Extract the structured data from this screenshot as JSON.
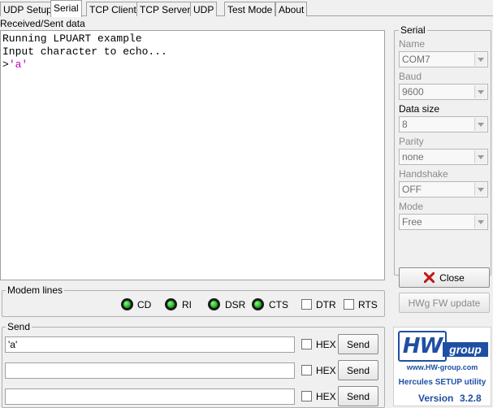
{
  "tabs": [
    {
      "label": "UDP Setup"
    },
    {
      "label": "Serial"
    },
    {
      "label": "TCP Client"
    },
    {
      "label": "TCP Server"
    },
    {
      "label": "UDP"
    },
    {
      "label": "Test Mode"
    },
    {
      "label": "About"
    }
  ],
  "active_tab": "Serial",
  "received": {
    "label": "Received/Sent data",
    "lines": [
      {
        "text": "Running LPUART example"
      },
      {
        "text": "Input character to echo..."
      }
    ],
    "prompt": ">",
    "echo": "'a'"
  },
  "serial": {
    "title": "Serial",
    "name_label": "Name",
    "name_value": "COM7",
    "baud_label": "Baud",
    "baud_value": "9600",
    "datasize_label": "Data size",
    "datasize_value": "8",
    "parity_label": "Parity",
    "parity_value": "none",
    "handshake_label": "Handshake",
    "handshake_value": "OFF",
    "mode_label": "Mode",
    "mode_value": "Free",
    "close_label": "Close",
    "hwg_label": "HWg FW update"
  },
  "modem": {
    "title": "Modem lines",
    "leds": [
      {
        "label": "CD"
      },
      {
        "label": "RI"
      },
      {
        "label": "DSR"
      },
      {
        "label": "CTS"
      }
    ],
    "checks": [
      {
        "label": "DTR"
      },
      {
        "label": "RTS"
      }
    ]
  },
  "send": {
    "title": "Send",
    "rows": [
      {
        "value": "'a'",
        "hex_label": "HEX",
        "button": "Send"
      },
      {
        "value": "",
        "hex_label": "HEX",
        "button": "Send"
      },
      {
        "value": "",
        "hex_label": "HEX",
        "button": "Send"
      }
    ]
  },
  "logo": {
    "brand_hw": "HW",
    "brand_group": "group",
    "url": "www.HW-group.com",
    "product": "Hercules SETUP utility",
    "version_label": "Version",
    "version": "3.2.8"
  },
  "colors": {
    "echo_text": "#c000c0",
    "led_on": "#18a018",
    "logo_blue": "#1f4fa3",
    "close_x": "#c01818"
  }
}
